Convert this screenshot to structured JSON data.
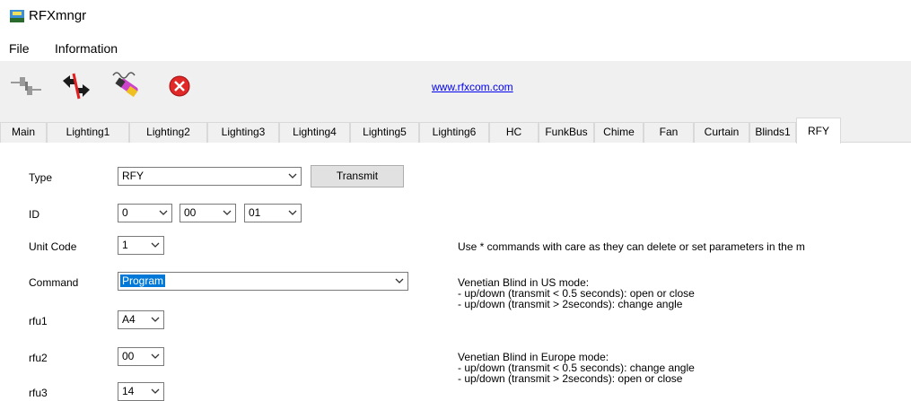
{
  "window": {
    "title": "RFXmngr"
  },
  "menu": {
    "items": [
      "File",
      "Information"
    ]
  },
  "toolbar": {
    "link": "www.rfxcom.com",
    "icons": [
      "connect-icon",
      "disconnect-icon",
      "record-icon",
      "stop-icon"
    ]
  },
  "tabs": [
    "Main",
    "Lighting1",
    "Lighting2",
    "Lighting3",
    "Lighting4",
    "Lighting5",
    "Lighting6",
    "HC",
    "FunkBus",
    "Chime",
    "Fan",
    "Curtain",
    "Blinds1",
    "RFY"
  ],
  "active_tab": "RFY",
  "form": {
    "type_label": "Type",
    "type_value": "RFY",
    "transmit_label": "Transmit",
    "id_label": "ID",
    "id1": "0",
    "id2": "00",
    "id3": "01",
    "unit_code_label": "Unit Code",
    "unit_code_value": "1",
    "command_label": "Command",
    "command_value": "Program",
    "rfu1_label": "rfu1",
    "rfu1_value": "A4",
    "rfu2_label": "rfu2",
    "rfu2_value": "00",
    "rfu3_label": "rfu3",
    "rfu3_value": "14"
  },
  "notes": {
    "warning": "Use * commands with care as they can delete or set parameters in the m",
    "us_title": "Venetian Blind in US mode:",
    "us_line1": "- up/down (transmit < 0.5 seconds): open or close",
    "us_line2": "- up/down (transmit > 2seconds): change angle",
    "eu_title": "Venetian Blind in Europe mode:",
    "eu_line1": "- up/down (transmit < 0.5 seconds): change angle",
    "eu_line2": "- up/down (transmit > 2seconds): open or close"
  }
}
